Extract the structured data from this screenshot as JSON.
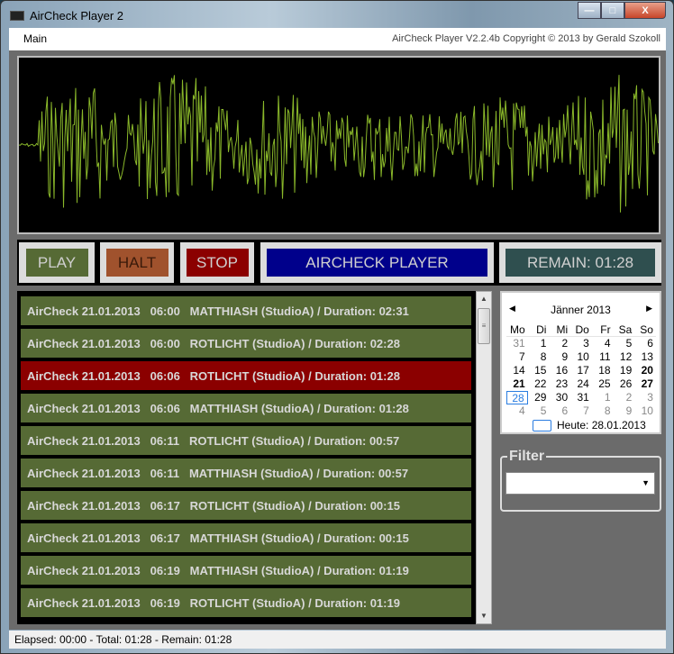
{
  "window": {
    "title": "AirCheck Player 2",
    "controls": {
      "minimize": "—",
      "maximize": "□",
      "close": "X"
    }
  },
  "menu": {
    "main": "Main",
    "copyright": "AirCheck Player V2.2.4b Copyright ©  2013 by Gerald Szokoll"
  },
  "colors": {
    "waveform": "#8ab82a",
    "play": "#566a35",
    "halt": "#a0522d",
    "stop": "#8b0000",
    "title_btn": "#00008b",
    "remain": "#2f4f4f",
    "selected_row": "#8b0000"
  },
  "buttons": {
    "play": "PLAY",
    "halt": "HALT",
    "stop": "STOP",
    "title": "AIRCHECK PLAYER",
    "remain": "REMAIN:  01:28"
  },
  "playlist": [
    "AirCheck 21.01.2013   06:00   MATTHIASH (StudioA) / Duration: 02:31",
    "AirCheck 21.01.2013   06:00   ROTLICHT (StudioA) / Duration: 02:28",
    "AirCheck 21.01.2013   06:06   ROTLICHT (StudioA) / Duration: 01:28",
    "AirCheck 21.01.2013   06:06   MATTHIASH (StudioA) / Duration: 01:28",
    "AirCheck 21.01.2013   06:11   ROTLICHT (StudioA) / Duration: 00:57",
    "AirCheck 21.01.2013   06:11   MATTHIASH (StudioA) / Duration: 00:57",
    "AirCheck 21.01.2013   06:17   ROTLICHT (StudioA) / Duration: 00:15",
    "AirCheck 21.01.2013   06:17   MATTHIASH (StudioA) / Duration: 00:15",
    "AirCheck 21.01.2013   06:19   MATTHIASH (StudioA) / Duration: 01:19",
    "AirCheck 21.01.2013   06:19   ROTLICHT (StudioA) / Duration: 01:19"
  ],
  "selected_index": 2,
  "calendar": {
    "month": "Jänner 2013",
    "days": [
      "Mo",
      "Di",
      "Mi",
      "Do",
      "Fr",
      "Sa",
      "So"
    ],
    "cells": [
      "31",
      "1",
      "2",
      "3",
      "4",
      "5",
      "6",
      "7",
      "8",
      "9",
      "10",
      "11",
      "12",
      "13",
      "14",
      "15",
      "16",
      "17",
      "18",
      "19",
      "20",
      "21",
      "22",
      "23",
      "24",
      "25",
      "26",
      "27",
      "28",
      "29",
      "30",
      "31",
      "1",
      "2",
      "3",
      "4",
      "5",
      "6",
      "7",
      "8",
      "9",
      "10"
    ],
    "today": "Heute: 28.01.2013"
  },
  "filter": {
    "label": "Filter",
    "value": ""
  },
  "status": "Elapsed: 00:00 - Total: 01:28 - Remain: 01:28"
}
